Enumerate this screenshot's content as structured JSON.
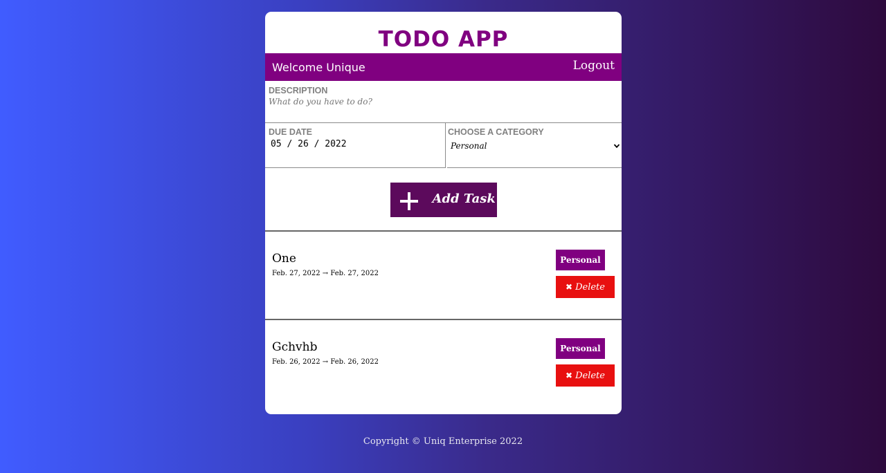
{
  "app": {
    "title": "TODO APP"
  },
  "header": {
    "welcome": "Welcome Unique",
    "logout_label": "Logout"
  },
  "form": {
    "description_label": "DESCRIPTION",
    "description_placeholder": "What do you have to do?",
    "due_date_label": "DUE DATE",
    "due_date_value": "05 / 26 / 2022",
    "category_label": "CHOOSE A CATEGORY",
    "category_value": "Personal",
    "add_button_label": "Add Task",
    "add_button_icon": "plus-icon"
  },
  "tasks": [
    {
      "title": "One",
      "dates": "Feb. 27, 2022 → Feb. 27, 2022",
      "category": "Personal",
      "delete_label": "Delete",
      "delete_icon_glyph": "✖"
    },
    {
      "title": "Gchvhb",
      "dates": "Feb. 26, 2022 → Feb. 26, 2022",
      "category": "Personal",
      "delete_label": "Delete",
      "delete_icon_glyph": "✖"
    }
  ],
  "footer": {
    "copyright": "Copyright © Uniq Enterprise 2022"
  },
  "colors": {
    "brand_purple": "#800080",
    "add_button": "#5c0a5c",
    "delete_red": "#e81010"
  }
}
